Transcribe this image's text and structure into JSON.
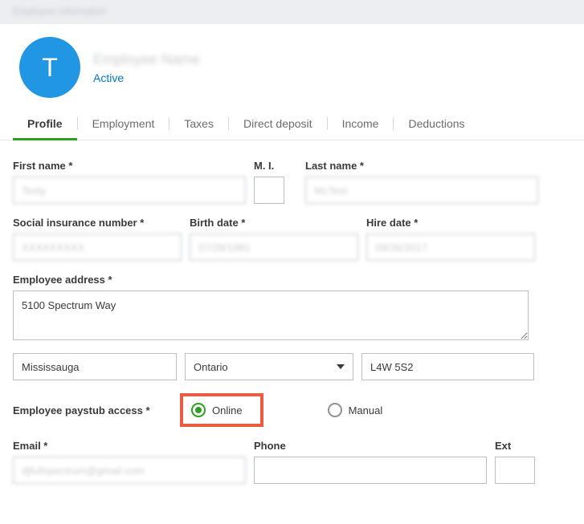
{
  "topbar": {
    "text": "Employee information"
  },
  "header": {
    "avatar_letter": "T",
    "employee_name": "Employee Name",
    "status": "Active"
  },
  "tabs": [
    {
      "label": "Profile",
      "active": true
    },
    {
      "label": "Employment",
      "active": false
    },
    {
      "label": "Taxes",
      "active": false
    },
    {
      "label": "Direct deposit",
      "active": false
    },
    {
      "label": "Income",
      "active": false
    },
    {
      "label": "Deductions",
      "active": false
    }
  ],
  "form": {
    "first_name": {
      "label": "First name *",
      "value": "Testy"
    },
    "mi": {
      "label": "M. I.",
      "value": ""
    },
    "last_name": {
      "label": "Last name *",
      "value": "McTest"
    },
    "sin": {
      "label": "Social insurance number *",
      "value": "XXXXXXXXX"
    },
    "birth_date": {
      "label": "Birth date *",
      "value": "07/28/1981"
    },
    "hire_date": {
      "label": "Hire date *",
      "value": "09/26/2017"
    },
    "address": {
      "label": "Employee address *",
      "value": "5100 Spectrum Way"
    },
    "city": {
      "value": "Mississauga"
    },
    "province": {
      "value": "Ontario"
    },
    "postal": {
      "value": "L4W 5S2"
    },
    "paystub": {
      "label": "Employee paystub access *",
      "options": {
        "online": "Online",
        "manual": "Manual"
      },
      "selected": "online"
    },
    "email": {
      "label": "Email *",
      "value": "djfullspectrum@gmail.com"
    },
    "phone": {
      "label": "Phone",
      "value": ""
    },
    "ext": {
      "label": "Ext",
      "value": ""
    }
  }
}
